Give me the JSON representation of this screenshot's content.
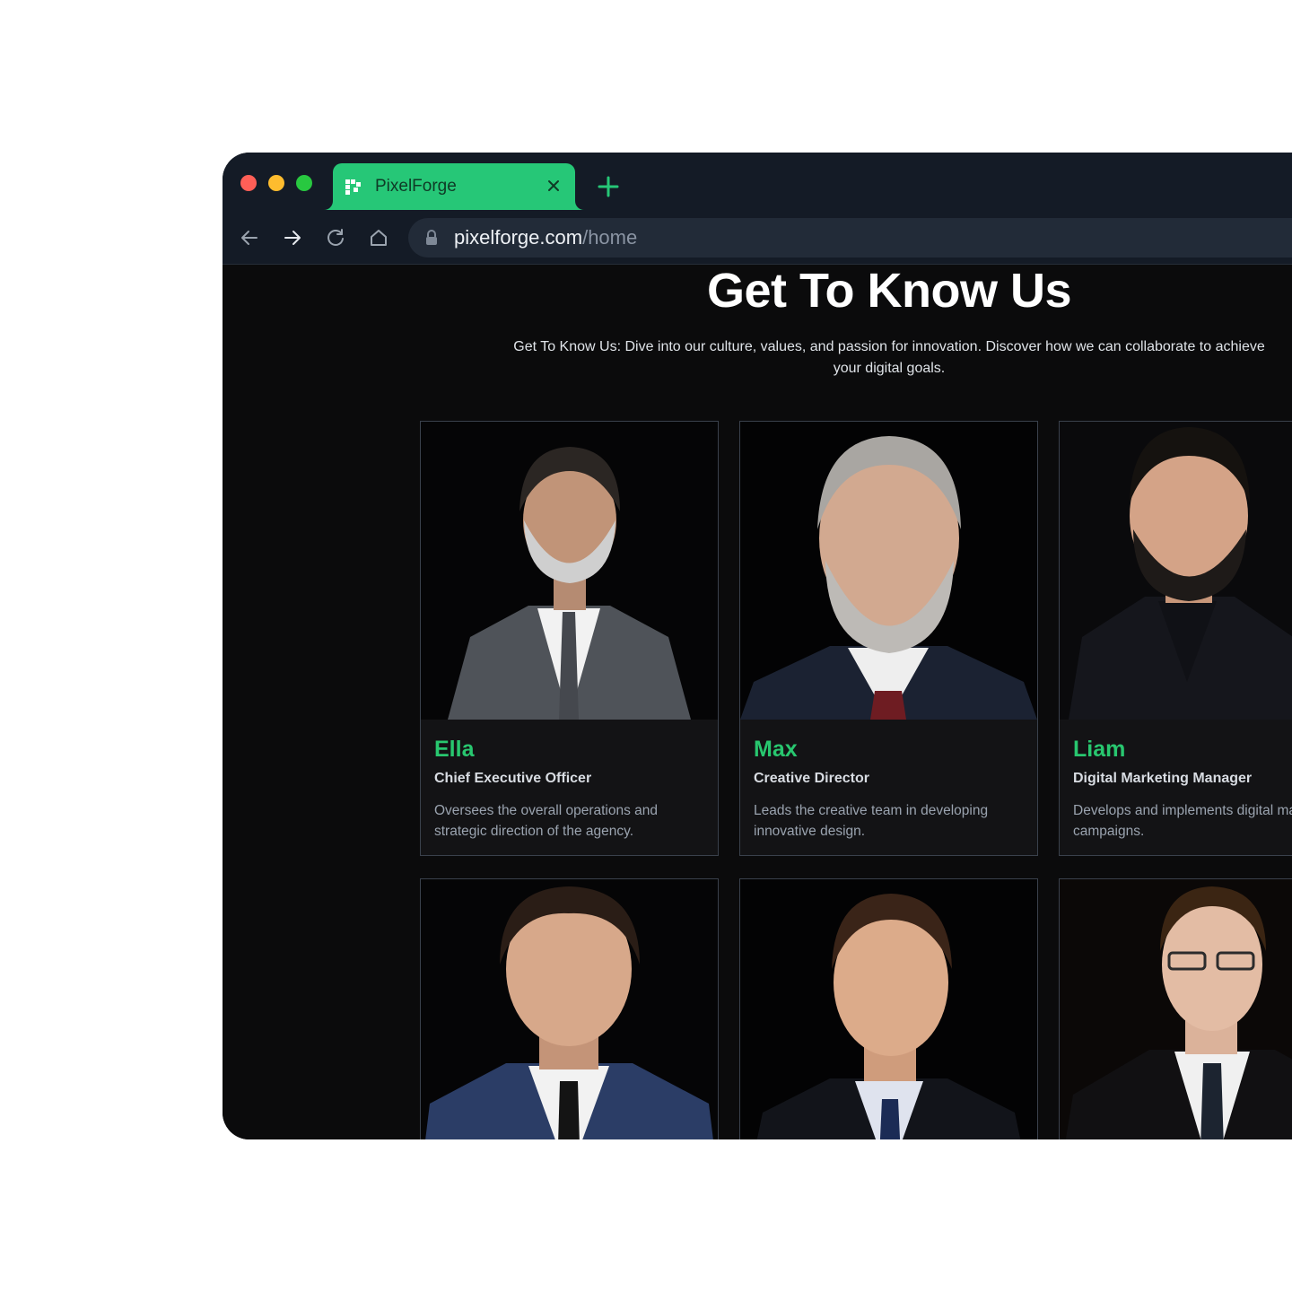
{
  "browser": {
    "tab_title": "PixelForge",
    "url_domain": "pixelforge.com",
    "url_path": "/home",
    "accent_color": "#26c777"
  },
  "page": {
    "title": "Get To Know Us",
    "subtitle": "Get To Know Us: Dive into our culture, values, and passion for innovation. Discover how we can collaborate to achieve your digital goals."
  },
  "team": [
    {
      "name": "Ella",
      "role": "Chief Executive Officer",
      "description": "Oversees the overall operations and strategic direction of the agency."
    },
    {
      "name": "Max",
      "role": "Creative Director",
      "description": "Leads the creative team in developing innovative design."
    },
    {
      "name": "Liam",
      "role": "Digital Marketing Manager",
      "description": "Develops and implements digital marketing campaigns."
    }
  ],
  "icons": [
    "pixelforge-logo-icon",
    "close-icon",
    "plus-icon",
    "back-arrow-icon",
    "forward-arrow-icon",
    "reload-icon",
    "home-icon",
    "lock-icon"
  ]
}
